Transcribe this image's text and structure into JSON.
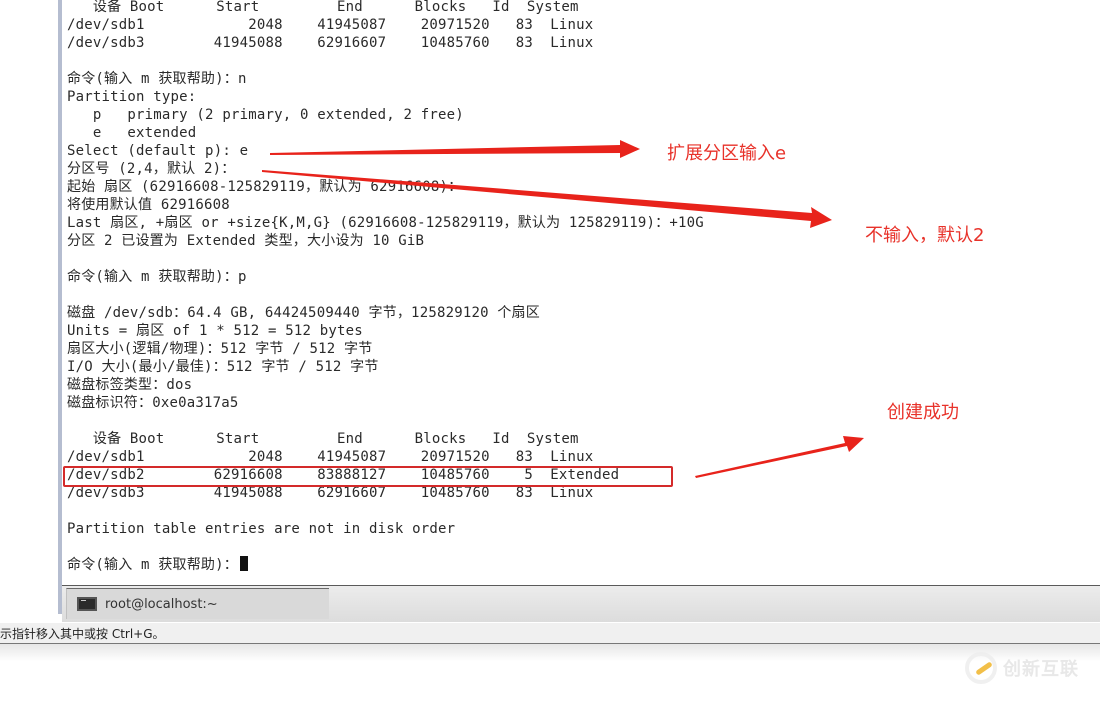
{
  "terminal": {
    "lines": [
      "   设备 Boot      Start         End      Blocks   Id  System",
      "/dev/sdb1            2048    41945087    20971520   83  Linux",
      "/dev/sdb3        41945088    62916607    10485760   83  Linux",
      "",
      "命令(输入 m 获取帮助)：n",
      "Partition type:",
      "   p   primary (2 primary, 0 extended, 2 free)",
      "   e   extended",
      "Select (default p): e",
      "分区号 (2,4，默认 2)：",
      "起始 扇区 (62916608-125829119，默认为 62916608)：",
      "将使用默认值 62916608",
      "Last 扇区, +扇区 or +size{K,M,G} (62916608-125829119，默认为 125829119)：+10G",
      "分区 2 已设置为 Extended 类型，大小设为 10 GiB",
      "",
      "命令(输入 m 获取帮助)：p",
      "",
      "磁盘 /dev/sdb：64.4 GB, 64424509440 字节，125829120 个扇区",
      "Units = 扇区 of 1 * 512 = 512 bytes",
      "扇区大小(逻辑/物理)：512 字节 / 512 字节",
      "I/O 大小(最小/最佳)：512 字节 / 512 字节",
      "磁盘标签类型：dos",
      "磁盘标识符：0xe0a317a5",
      "",
      "   设备 Boot      Start         End      Blocks   Id  System",
      "/dev/sdb1            2048    41945087    20971520   83  Linux",
      "/dev/sdb2        62916608    83888127    10485760    5  Extended",
      "/dev/sdb3        41945088    62916607    10485760   83  Linux",
      "",
      "Partition table entries are not in disk order",
      "",
      "命令(输入 m 获取帮助)："
    ],
    "partition_table_before": {
      "headers": [
        "设备",
        "Boot",
        "Start",
        "End",
        "Blocks",
        "Id",
        "System"
      ],
      "rows": [
        [
          "/dev/sdb1",
          "",
          "2048",
          "41945087",
          "20971520",
          "83",
          "Linux"
        ],
        [
          "/dev/sdb3",
          "",
          "41945088",
          "62916607",
          "10485760",
          "83",
          "Linux"
        ]
      ]
    },
    "partition_table_after": {
      "headers": [
        "设备",
        "Boot",
        "Start",
        "End",
        "Blocks",
        "Id",
        "System"
      ],
      "rows": [
        [
          "/dev/sdb1",
          "",
          "2048",
          "41945087",
          "20971520",
          "83",
          "Linux"
        ],
        [
          "/dev/sdb2",
          "",
          "62916608",
          "83888127",
          "10485760",
          "5",
          "Extended"
        ],
        [
          "/dev/sdb3",
          "",
          "41945088",
          "62916607",
          "10485760",
          "83",
          "Linux"
        ]
      ]
    }
  },
  "taskbar": {
    "items": [
      {
        "label": "root@localhost:~",
        "icon": "terminal-icon"
      }
    ]
  },
  "statusbar": {
    "text": "示指针移入其中或按 Ctrl+G。"
  },
  "annotations": {
    "extended_input": "扩展分区输入e",
    "default_two": "不输入，默认2",
    "created": "创建成功",
    "color": "#e8322a"
  },
  "watermark": {
    "text": "创新互联"
  }
}
